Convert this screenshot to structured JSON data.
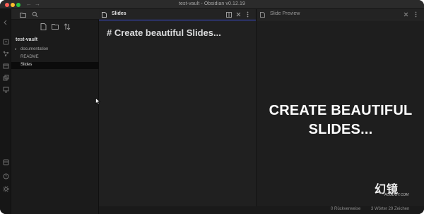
{
  "window": {
    "title": "test-vault - Obsidian v0.12.19"
  },
  "sidebar": {
    "vault_name": "test-vault",
    "items": [
      {
        "label": "documentation",
        "type": "folder"
      },
      {
        "label": "README",
        "type": "file"
      },
      {
        "label": "Slides",
        "type": "file",
        "active": true
      }
    ]
  },
  "editor": {
    "tab_title": "Slides",
    "content_line": "# Create beautiful Slides..."
  },
  "preview": {
    "tab_title": "Slide Preview",
    "slide_line1": "CREATE BEAUTIFUL",
    "slide_line2": "SLIDES..."
  },
  "status": {
    "backlinks": "0 Rückverweise",
    "counts": "3 Wörter  29 Zeichen"
  },
  "watermark": {
    "glyphs": "幻镜",
    "sub": "ACGDOY.COM"
  },
  "colors": {
    "accent": "#3d4fd6",
    "background": "#1e1e1e",
    "text": "#dcddde"
  }
}
